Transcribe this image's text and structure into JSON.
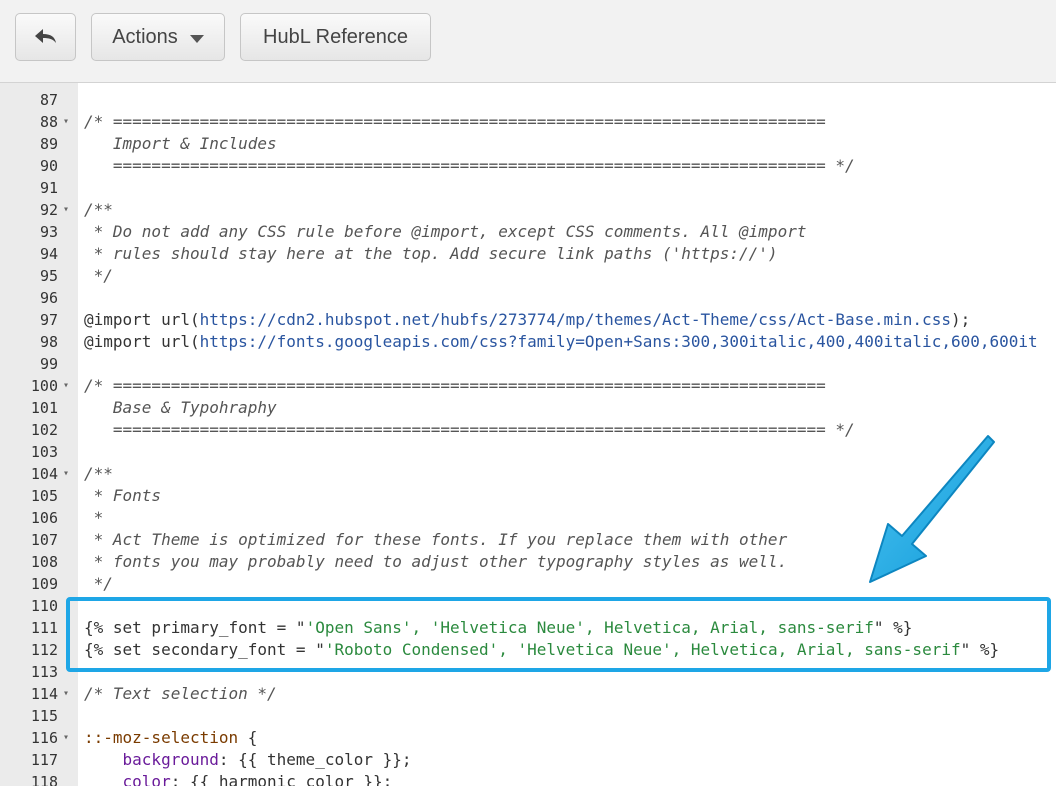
{
  "toolbar": {
    "back_icon": "back-arrow-icon",
    "actions_label": "Actions",
    "hubl_label": "HubL Reference"
  },
  "editor": {
    "lines": [
      {
        "n": "87",
        "fold": false,
        "parts": []
      },
      {
        "n": "88",
        "fold": true,
        "parts": [
          {
            "t": "/* ==========================================================================",
            "c": "cm"
          }
        ]
      },
      {
        "n": "89",
        "fold": false,
        "parts": [
          {
            "t": "   Import & Includes",
            "c": "cm"
          }
        ]
      },
      {
        "n": "90",
        "fold": false,
        "parts": [
          {
            "t": "   ========================================================================== */",
            "c": "cm"
          }
        ]
      },
      {
        "n": "91",
        "fold": false,
        "parts": []
      },
      {
        "n": "92",
        "fold": true,
        "parts": [
          {
            "t": "/**",
            "c": "cm"
          }
        ]
      },
      {
        "n": "93",
        "fold": false,
        "parts": [
          {
            "t": " * Do not add any CSS rule before @import, except CSS comments. All @import",
            "c": "cm"
          }
        ]
      },
      {
        "n": "94",
        "fold": false,
        "parts": [
          {
            "t": " * rules should stay here at the top. Add secure link paths ('https://')",
            "c": "cm"
          }
        ]
      },
      {
        "n": "95",
        "fold": false,
        "parts": [
          {
            "t": " */",
            "c": "cm"
          }
        ]
      },
      {
        "n": "96",
        "fold": false,
        "parts": []
      },
      {
        "n": "97",
        "fold": false,
        "parts": [
          {
            "t": "@import url(",
            "c": "kw"
          },
          {
            "t": "https://cdn2.hubspot.net/hubfs/273774/mp/themes/Act-Theme/css/Act-Base.min.css",
            "c": "url"
          },
          {
            "t": ");",
            "c": "kw"
          }
        ]
      },
      {
        "n": "98",
        "fold": false,
        "parts": [
          {
            "t": "@import url(",
            "c": "kw"
          },
          {
            "t": "https://fonts.googleapis.com/css?family=Open+Sans:300,300italic,400,400italic,600,600it",
            "c": "url"
          }
        ]
      },
      {
        "n": "99",
        "fold": false,
        "parts": []
      },
      {
        "n": "100",
        "fold": true,
        "parts": [
          {
            "t": "/* ==========================================================================",
            "c": "cm"
          }
        ]
      },
      {
        "n": "101",
        "fold": false,
        "parts": [
          {
            "t": "   Base & Typohraphy",
            "c": "cm"
          }
        ]
      },
      {
        "n": "102",
        "fold": false,
        "parts": [
          {
            "t": "   ========================================================================== */",
            "c": "cm"
          }
        ]
      },
      {
        "n": "103",
        "fold": false,
        "parts": []
      },
      {
        "n": "104",
        "fold": true,
        "parts": [
          {
            "t": "/**",
            "c": "cm"
          }
        ]
      },
      {
        "n": "105",
        "fold": false,
        "parts": [
          {
            "t": " * Fonts",
            "c": "cm"
          }
        ]
      },
      {
        "n": "106",
        "fold": false,
        "parts": [
          {
            "t": " *",
            "c": "cm"
          }
        ]
      },
      {
        "n": "107",
        "fold": false,
        "parts": [
          {
            "t": " * Act Theme is optimized for these fonts. If you replace them with other",
            "c": "cm"
          }
        ]
      },
      {
        "n": "108",
        "fold": false,
        "parts": [
          {
            "t": " * fonts you may probably need to adjust other typography styles as well.",
            "c": "cm"
          }
        ]
      },
      {
        "n": "109",
        "fold": false,
        "parts": [
          {
            "t": " */",
            "c": "cm"
          }
        ]
      },
      {
        "n": "110",
        "fold": false,
        "parts": []
      },
      {
        "n": "111",
        "fold": false,
        "parts": [
          {
            "t": "{% set primary_font = \"",
            "c": "kw"
          },
          {
            "t": "'Open Sans', 'Helvetica Neue', Helvetica, Arial, sans-serif",
            "c": "str"
          },
          {
            "t": "\" %}",
            "c": "kw"
          }
        ]
      },
      {
        "n": "112",
        "fold": false,
        "parts": [
          {
            "t": "{% set secondary_font = \"",
            "c": "kw"
          },
          {
            "t": "'Roboto Condensed', 'Helvetica Neue', Helvetica, Arial, sans-serif",
            "c": "str"
          },
          {
            "t": "\" %}",
            "c": "kw"
          }
        ]
      },
      {
        "n": "113",
        "fold": false,
        "parts": []
      },
      {
        "n": "114",
        "fold": true,
        "parts": [
          {
            "t": "/* Text selection */",
            "c": "cm"
          }
        ]
      },
      {
        "n": "115",
        "fold": false,
        "parts": []
      },
      {
        "n": "116",
        "fold": true,
        "parts": [
          {
            "t": "::-moz-selection",
            "c": "sel"
          },
          {
            "t": " {",
            "c": "kw"
          }
        ]
      },
      {
        "n": "117",
        "fold": false,
        "parts": [
          {
            "t": "    ",
            "c": "kw"
          },
          {
            "t": "background",
            "c": "prop"
          },
          {
            "t": ": {{ theme_color }};",
            "c": "kw"
          }
        ]
      },
      {
        "n": "118",
        "fold": false,
        "parts": [
          {
            "t": "    ",
            "c": "kw"
          },
          {
            "t": "color",
            "c": "prop"
          },
          {
            "t": ": {{ harmonic_color }};",
            "c": "kw"
          }
        ]
      }
    ]
  },
  "colors": {
    "highlight": "#1ea6e6",
    "gutter": "#ebebeb",
    "toolbar": "#f2f2f2"
  }
}
